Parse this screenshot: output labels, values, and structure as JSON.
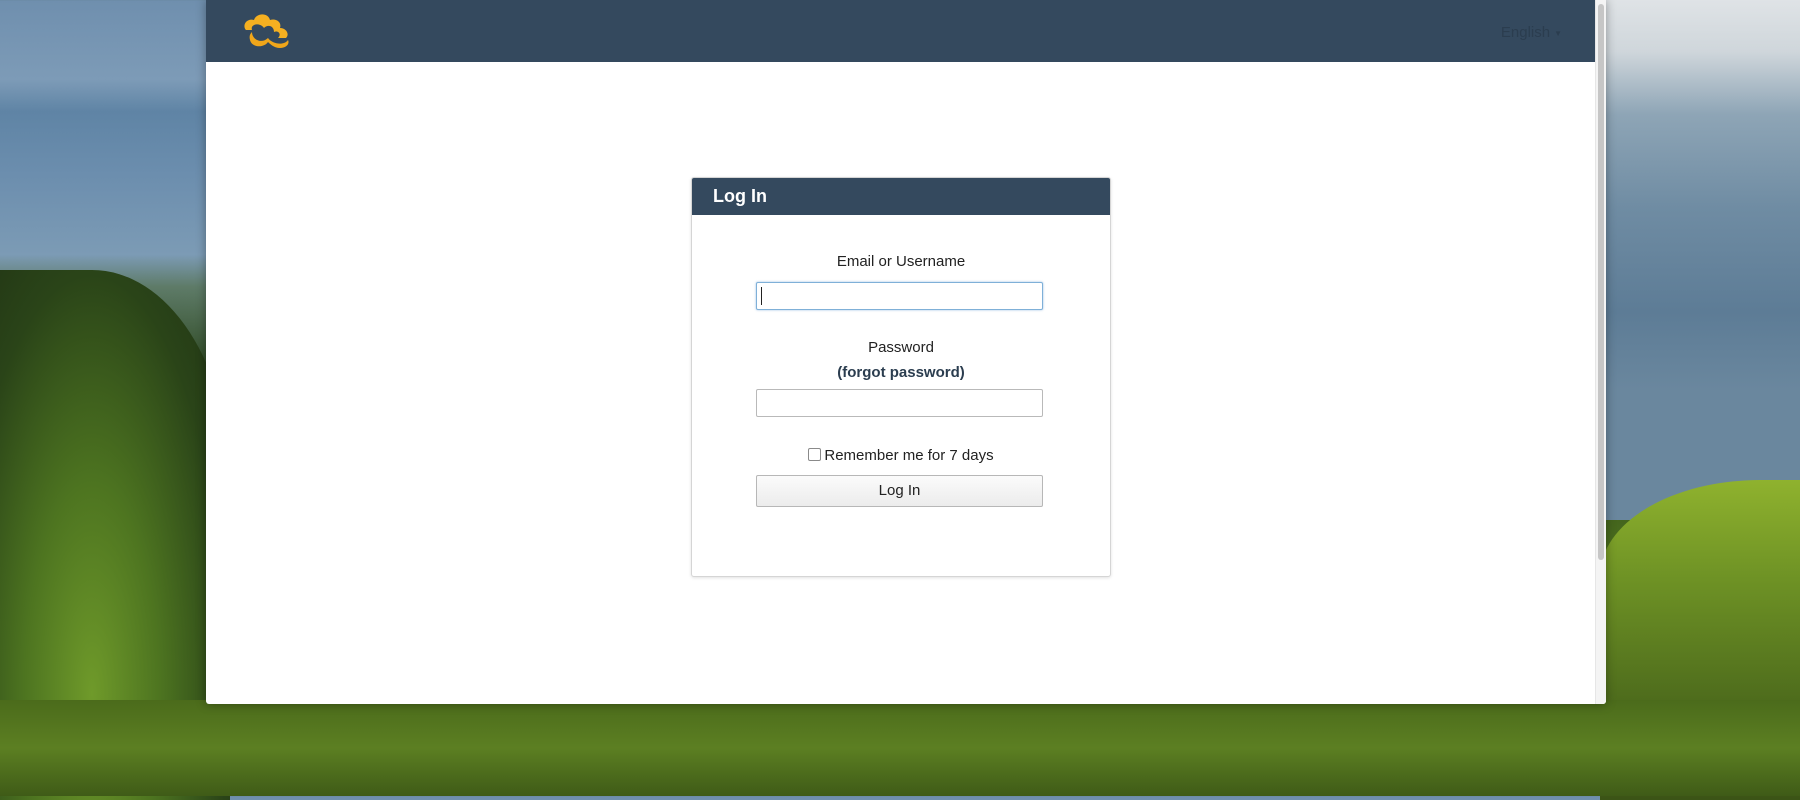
{
  "header": {
    "logo_icon": "cloud-logo-icon",
    "language": "English",
    "language_caret_icon": "caret-down-icon"
  },
  "login": {
    "title": "Log In",
    "username_label": "Email or Username",
    "username_value": "",
    "password_label": "Password",
    "forgot_password": "(forgot password)",
    "password_value": "",
    "remember_label": "Remember me for 7 days",
    "remember_checked": false,
    "submit_label": "Log In"
  },
  "colors": {
    "navbar": "#34495e",
    "logo": "#f5b021",
    "input_focus_border": "#7fb0d8"
  }
}
